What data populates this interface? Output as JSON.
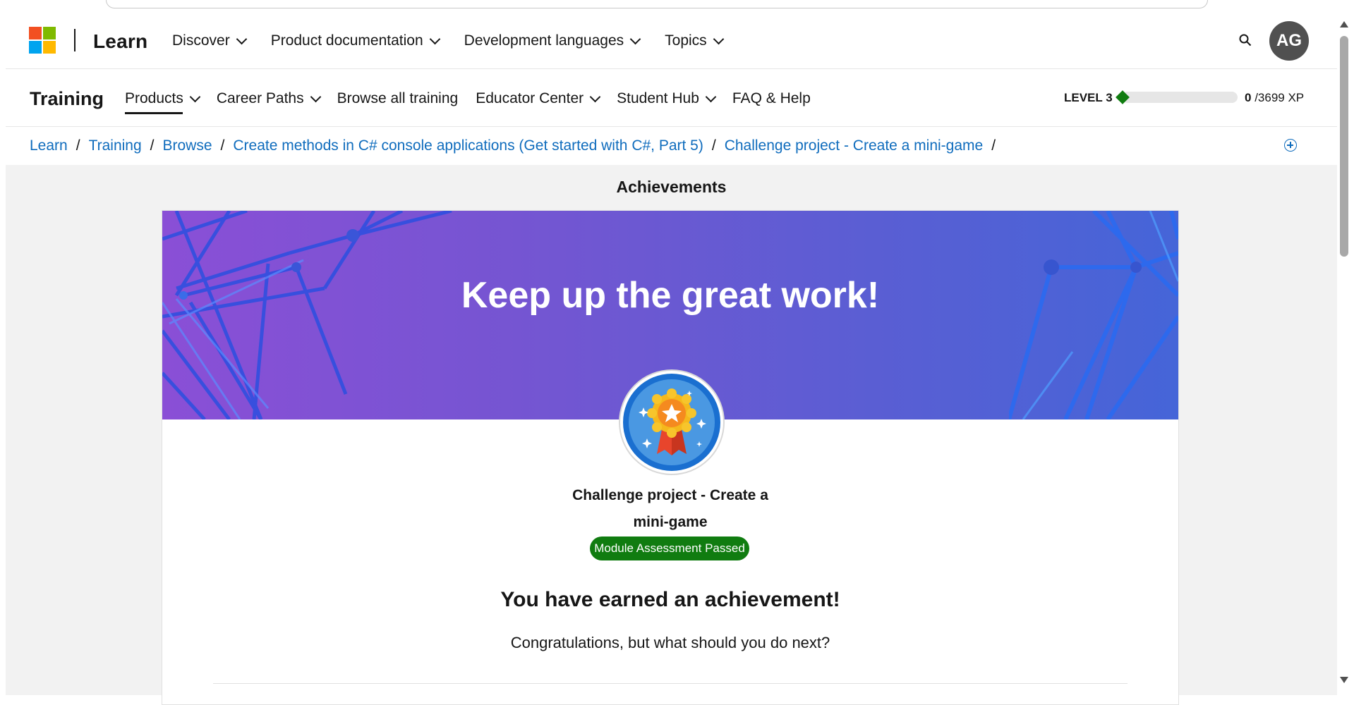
{
  "global_header": {
    "brand": "Learn",
    "nav": [
      {
        "label": "Discover"
      },
      {
        "label": "Product documentation"
      },
      {
        "label": "Development languages"
      },
      {
        "label": "Topics"
      }
    ],
    "avatar_initials": "AG"
  },
  "training_header": {
    "title": "Training",
    "nav": [
      {
        "label": "Products"
      },
      {
        "label": "Career Paths"
      },
      {
        "label": "Browse all training"
      },
      {
        "label": "Educator Center"
      },
      {
        "label": "Student Hub"
      },
      {
        "label": "FAQ & Help"
      }
    ],
    "level": "LEVEL 3",
    "xp_current": "0",
    "xp_total": "/3699 XP",
    "xp_progress_fraction": 0
  },
  "breadcrumb": [
    "Learn",
    "Training",
    "Browse",
    "Create methods in C# console applications (Get started with C#, Part 5)",
    "Challenge project - Create a mini-game"
  ],
  "main": {
    "section_title": "Achievements",
    "banner_title": "Keep up the great work!",
    "achievement_name_line1": "Challenge project - Create a",
    "achievement_name_line2": "mini-game",
    "status_badge": "Module Assessment Passed",
    "earned_heading": "You have earned an achievement!",
    "next_text": "Congratulations, but what should you do next?"
  },
  "colors": {
    "link": "#0f6cbd",
    "success": "#107c10",
    "banner_start": "#8a4fd6",
    "banner_end": "#4565d8"
  }
}
